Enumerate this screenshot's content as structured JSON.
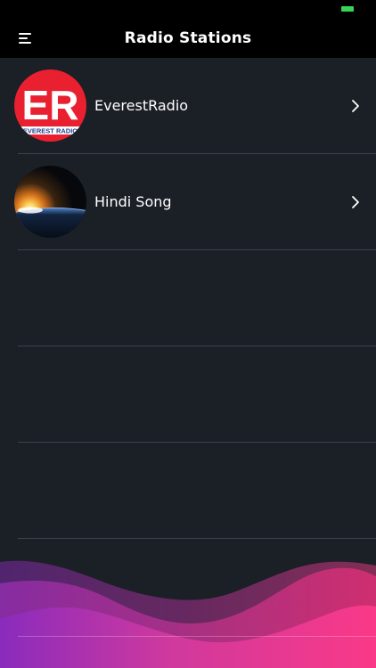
{
  "app": {
    "title": "Radio Stations"
  },
  "icons": {
    "menu": "hamburger-menu-icon",
    "chevron": "chevron-right-icon",
    "battery": "battery-icon"
  },
  "colors": {
    "background": "#1b1f26",
    "bar": "#000000",
    "battery": "#36d65a",
    "everest_red": "#e8202f",
    "wave_pink": "#e0317d",
    "wave_purple": "#8f2fb3"
  },
  "stations": [
    {
      "name": "EverestRadio",
      "logo_text": "ER",
      "logo_subtext": "EVEREST RADIO"
    },
    {
      "name": "Hindi Song"
    }
  ]
}
